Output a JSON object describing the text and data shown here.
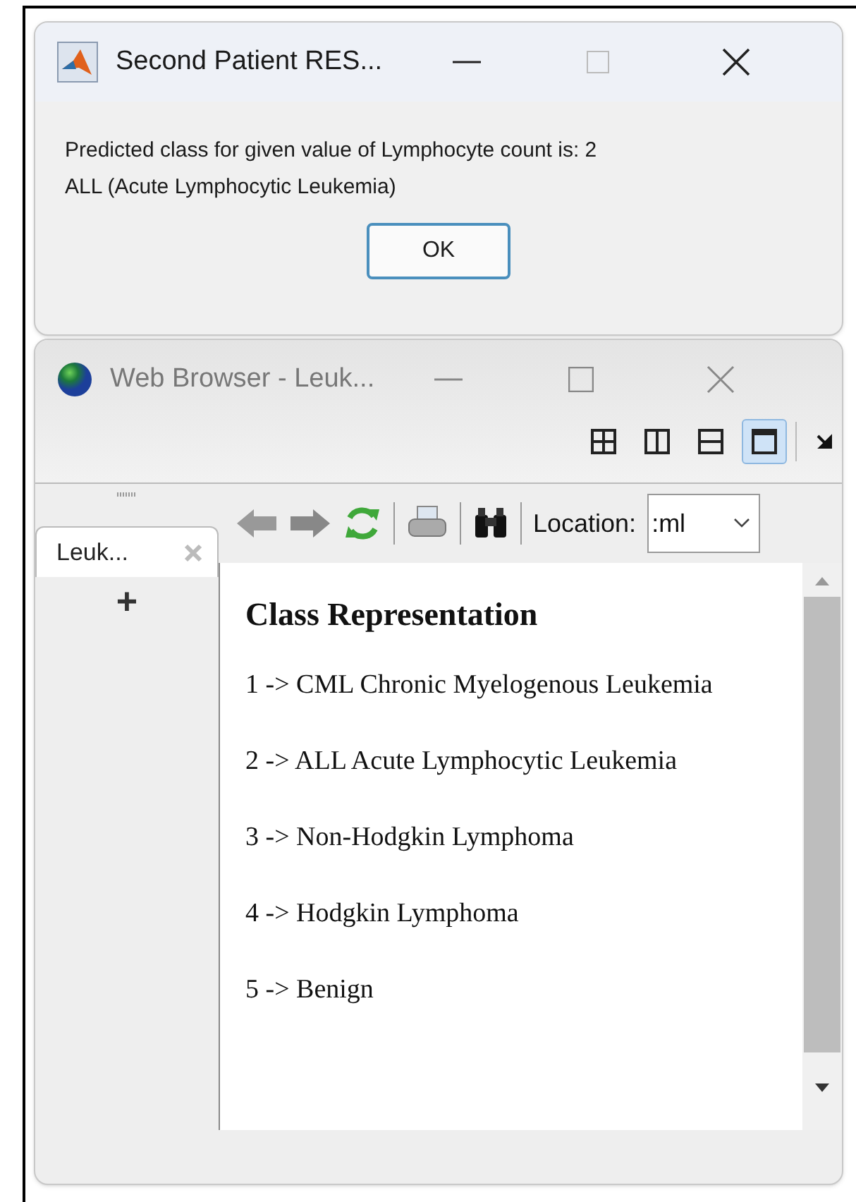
{
  "dialog": {
    "title": "Second Patient RES...",
    "message": "Predicted class for given value of Lymphocyte count is: 2\nALL (Acute Lymphocytic Leukemia)",
    "button": "OK"
  },
  "browser": {
    "title": "Web Browser - Leuk...",
    "layouts": [
      {
        "kind": "grid",
        "selected": false
      },
      {
        "kind": "columns",
        "selected": false
      },
      {
        "kind": "rows",
        "selected": false
      },
      {
        "kind": "single",
        "selected": true
      }
    ],
    "tabs": [
      {
        "label": "Leuk...",
        "selected": true
      }
    ],
    "add_tab": "+",
    "location_label": "Location:",
    "location_value": ":ml",
    "page": {
      "heading": "Class Representation",
      "items": [
        "1 -> CML Chronic Myelogenous Leukemia",
        "2 -> ALL Acute Lymphocytic Leukemia",
        "3 -> Non-Hodgkin Lymphoma",
        "4 -> Hodgkin Lymphoma",
        "5 -> Benign"
      ]
    }
  }
}
